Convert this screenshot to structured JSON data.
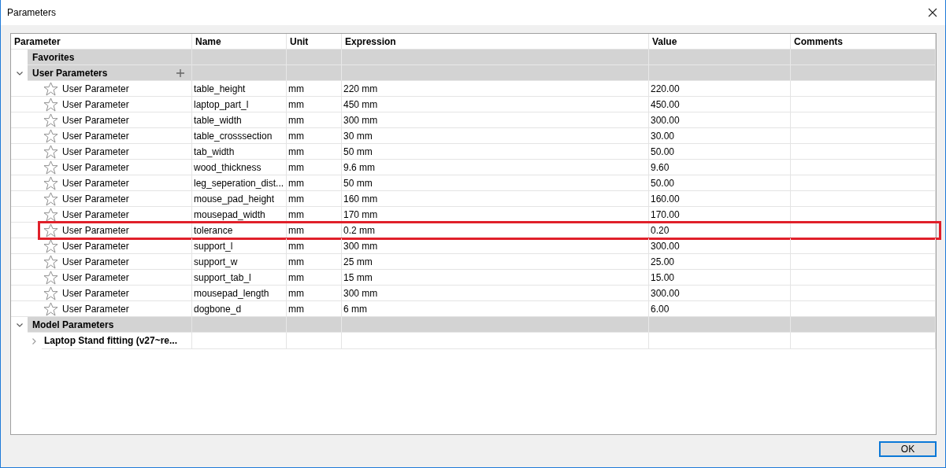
{
  "window": {
    "title": "Parameters"
  },
  "columns": [
    "Parameter",
    "Name",
    "Unit",
    "Expression",
    "Value",
    "Comments"
  ],
  "groups": [
    {
      "label": "Favorites",
      "can_add": false
    },
    {
      "label": "User Parameters",
      "expanded": true,
      "can_add": true,
      "children": [
        {
          "kind": "param",
          "type": "User Parameter",
          "favorite": false,
          "name": "table_height",
          "unit": "mm",
          "expression": "220 mm",
          "value": "220.00",
          "highlighted": false
        },
        {
          "kind": "param",
          "type": "User Parameter",
          "favorite": false,
          "name": "laptop_part_l",
          "unit": "mm",
          "expression": "450 mm",
          "value": "450.00",
          "highlighted": false
        },
        {
          "kind": "param",
          "type": "User Parameter",
          "favorite": false,
          "name": "table_width",
          "unit": "mm",
          "expression": "300 mm",
          "value": "300.00",
          "highlighted": false
        },
        {
          "kind": "param",
          "type": "User Parameter",
          "favorite": false,
          "name": "table_crosssection",
          "unit": "mm",
          "expression": "30 mm",
          "value": "30.00",
          "highlighted": false
        },
        {
          "kind": "param",
          "type": "User Parameter",
          "favorite": false,
          "name": "tab_width",
          "unit": "mm",
          "expression": "50 mm",
          "value": "50.00",
          "highlighted": false
        },
        {
          "kind": "param",
          "type": "User Parameter",
          "favorite": false,
          "name": "wood_thickness",
          "unit": "mm",
          "expression": "9.6 mm",
          "value": "9.60",
          "highlighted": false
        },
        {
          "kind": "param",
          "type": "User Parameter",
          "favorite": false,
          "name": "leg_seperation_dist...",
          "unit": "mm",
          "expression": "50 mm",
          "value": "50.00",
          "highlighted": false
        },
        {
          "kind": "param",
          "type": "User Parameter",
          "favorite": false,
          "name": "mouse_pad_height",
          "unit": "mm",
          "expression": "160 mm",
          "value": "160.00",
          "highlighted": false
        },
        {
          "kind": "param",
          "type": "User Parameter",
          "favorite": false,
          "name": "mousepad_width",
          "unit": "mm",
          "expression": "170 mm",
          "value": "170.00",
          "highlighted": false
        },
        {
          "kind": "param",
          "type": "User Parameter",
          "favorite": false,
          "name": "tolerance",
          "unit": "mm",
          "expression": "0.2 mm",
          "value": "0.20",
          "highlighted": true
        },
        {
          "kind": "param",
          "type": "User Parameter",
          "favorite": false,
          "name": "support_l",
          "unit": "mm",
          "expression": "300 mm",
          "value": "300.00",
          "highlighted": false
        },
        {
          "kind": "param",
          "type": "User Parameter",
          "favorite": false,
          "name": "support_w",
          "unit": "mm",
          "expression": "25 mm",
          "value": "25.00",
          "highlighted": false
        },
        {
          "kind": "param",
          "type": "User Parameter",
          "favorite": false,
          "name": "support_tab_l",
          "unit": "mm",
          "expression": "15 mm",
          "value": "15.00",
          "highlighted": false
        },
        {
          "kind": "param",
          "type": "User Parameter",
          "favorite": false,
          "name": "mousepad_length",
          "unit": "mm",
          "expression": "300 mm",
          "value": "300.00",
          "highlighted": false
        },
        {
          "kind": "param",
          "type": "User Parameter",
          "favorite": false,
          "name": "dogbone_d",
          "unit": "mm",
          "expression": "6 mm",
          "value": "6.00",
          "highlighted": false
        }
      ]
    },
    {
      "label": "Model Parameters",
      "expanded": true,
      "can_add": false,
      "children": [
        {
          "kind": "component",
          "label": "Laptop Stand fitting (v27~re...",
          "expanded": false
        }
      ]
    }
  ],
  "ok_button": "OK"
}
